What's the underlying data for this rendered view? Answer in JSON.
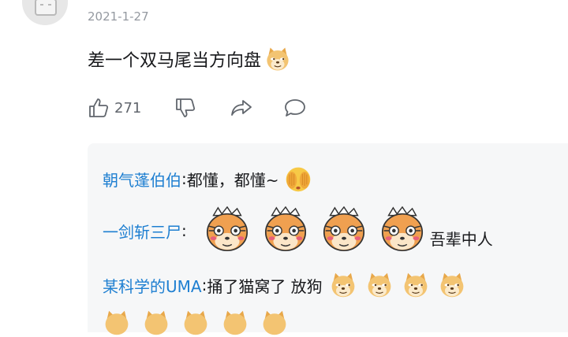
{
  "comment": {
    "date": "2021-1-27",
    "text": "差一个双马尾当方向盘",
    "like_count": "271",
    "emoji": "doge-emoji"
  },
  "replies": [
    {
      "user": "朝气蓬伯伯",
      "sep": ":",
      "text": " 都懂，都懂~",
      "emoji": "cover-face-emoji"
    },
    {
      "user": "一剑斩三尸",
      "sep": ":",
      "text": "吾辈中人",
      "emoji": "tiger-emoji"
    },
    {
      "user": "某科学的UMA",
      "sep": ":",
      "text": " 捅了猫窝了 放狗",
      "emoji": "doge-emoji"
    }
  ],
  "colors": {
    "username": "#1e7fd1",
    "meta": "#9499a0",
    "reply_bg": "#f6f7f8"
  }
}
